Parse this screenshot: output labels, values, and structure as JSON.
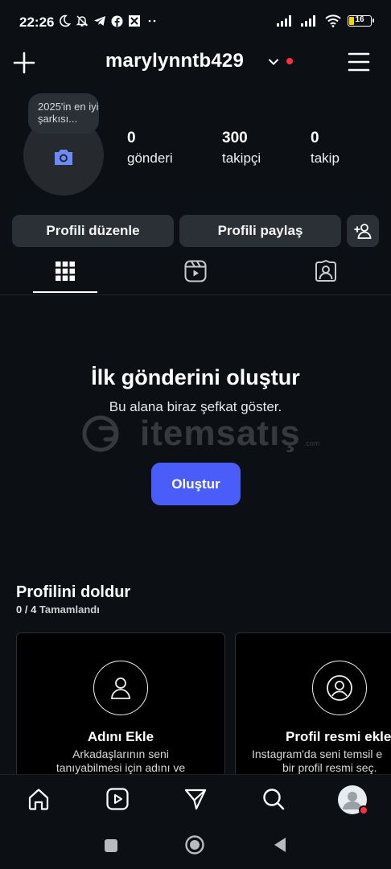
{
  "status_bar": {
    "time": "22:26",
    "battery": "16"
  },
  "header": {
    "username": "marylynntb429",
    "accent_red": "#ff3040"
  },
  "profile": {
    "note": "2025'in en iyi şarkısı...",
    "stats": [
      {
        "value": "0",
        "label": "gönderi"
      },
      {
        "value": "300",
        "label": "takipçi"
      },
      {
        "value": "0",
        "label": "takip"
      }
    ]
  },
  "actions": {
    "edit_profile": "Profili düzenle",
    "share_profile": "Profili paylaş"
  },
  "tabs": [
    {
      "icon": "grid-icon",
      "active": true
    },
    {
      "icon": "reels-icon",
      "active": false
    },
    {
      "icon": "tagged-icon",
      "active": false
    }
  ],
  "empty_state": {
    "title": "İlk gönderini oluştur",
    "subtitle": "Bu alana biraz şefkat göster.",
    "button": "Oluştur",
    "button_color": "#4a5df9"
  },
  "watermark": {
    "text": "itemsatış",
    "small": ".com"
  },
  "profile_fill": {
    "title": "Profilini doldur",
    "progress_done": "0 / 4",
    "progress_label": "Tamamlandı",
    "cards": [
      {
        "icon": "person-icon",
        "title": "Adını Ekle",
        "text_1": "Arkadaşlarının seni",
        "text_2": "tanıyabilmesi için adını ve"
      },
      {
        "icon": "profile-photo-icon",
        "title": "Profil resmi ekle",
        "text_1": "Instagram'da seni temsil e",
        "text_2": "bir profil resmi seç."
      }
    ]
  },
  "bottom_nav": [
    "home-icon",
    "reels-icon",
    "direct-icon",
    "search-icon",
    "profile-avatar"
  ]
}
